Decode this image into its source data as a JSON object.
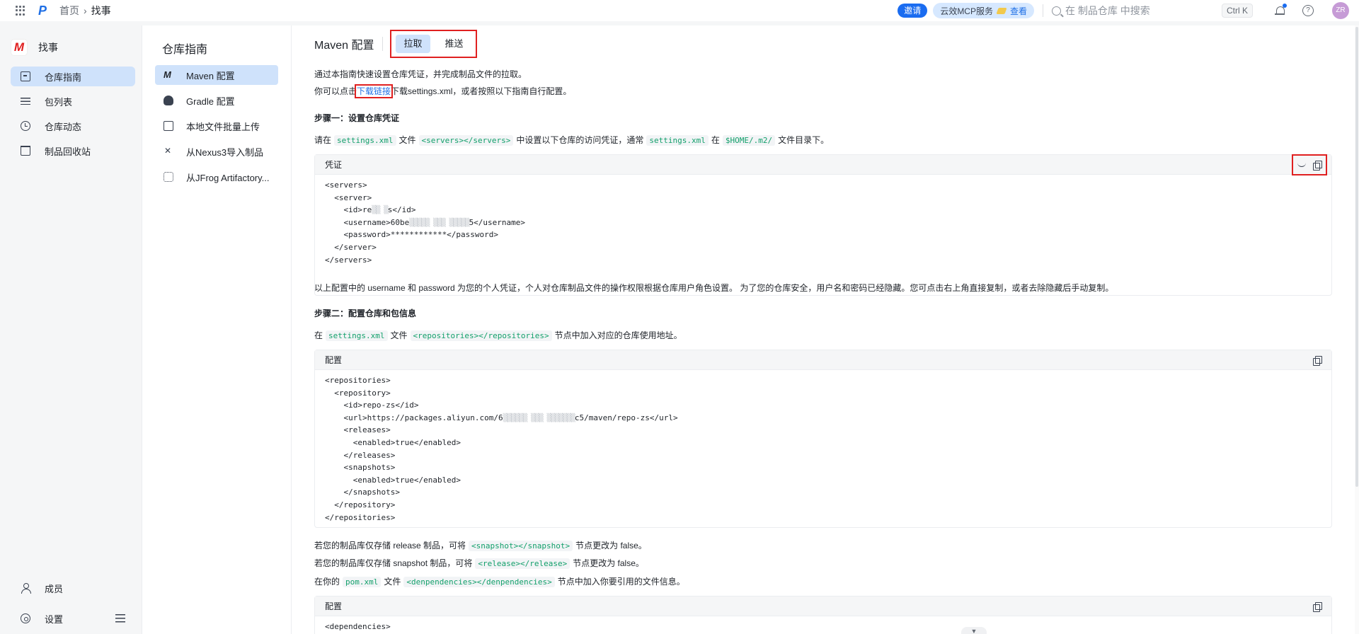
{
  "topbar": {
    "breadcrumb": {
      "home": "首页",
      "separator": "›",
      "current": "找事"
    },
    "invite_label": "邀请",
    "mcp_label": "云效MCP服务",
    "mcp_link": "查看",
    "search_placeholder": "在 制品仓库 中搜索",
    "shortcut": "Ctrl K",
    "avatar_initials": "ZR"
  },
  "leftnav": {
    "brand_logo": "M",
    "brand_name": "找事",
    "items": [
      {
        "label": "仓库指南",
        "icon": "doc-icon",
        "active": true
      },
      {
        "label": "包列表",
        "icon": "list-icon"
      },
      {
        "label": "仓库动态",
        "icon": "clock-icon"
      },
      {
        "label": "制品回收站",
        "icon": "trash-icon"
      }
    ],
    "bottom": [
      {
        "label": "成员",
        "icon": "user-icon"
      },
      {
        "label": "设置",
        "icon": "gear-icon"
      }
    ]
  },
  "midpanel": {
    "title": "仓库指南",
    "items": [
      {
        "label": "Maven 配置",
        "icon": "M",
        "active": true
      },
      {
        "label": "Gradle 配置",
        "icon": "gradle-icon"
      },
      {
        "label": "本地文件批量上传",
        "icon": "upload-icon"
      },
      {
        "label": "从Nexus3导入制品",
        "icon": "nexus-icon"
      },
      {
        "label": "从JFrog Artifactory...",
        "icon": "jfrog-icon"
      }
    ]
  },
  "content": {
    "title": "Maven 配置",
    "tabs": [
      "拉取",
      "推送"
    ],
    "intro1": "通过本指南快速设置仓库凭证，并完成制品文件的拉取。",
    "intro2_pre": "你可以点击",
    "intro2_link": "下载链接",
    "intro2_post": "下载settings.xml，或者按照以下指南自行配置。",
    "step1": "步骤一：设置仓库凭证",
    "step1_desc": {
      "t1": "请在",
      "c1": "settings.xml",
      "t2": "文件",
      "c2": "<servers></servers>",
      "t3": "中设置以下仓库的访问凭证，通常",
      "c3": "settings.xml",
      "t4": "在",
      "c4": "$HOME/.m2/",
      "t5": "文件目录下。"
    },
    "cred_panel_title": "凭证",
    "cred_code": {
      "l1": "<servers>",
      "l2": "  <server>",
      "l3_a": "    <id>re",
      "l3_blur": "▒▒ ▒",
      "l3_b": "s</id>",
      "l4_a": "    <username>60be",
      "l4_blur": "▒▒▒▒▒ ▒▒▒ ▒▒▒▒▒",
      "l4_b": "5</username>",
      "l5": "    <password>************</password>",
      "l6": "  </server>",
      "l7": "</servers>"
    },
    "cred_note": "以上配置中的 username 和 password 为您的个人凭证，个人对仓库制品文件的操作权限根据仓库用户角色设置。 为了您的仓库安全，用户名和密码已经隐藏。您可点击右上角直接复制，或者去除隐藏后手动复制。",
    "step2": "步骤二：配置仓库和包信息",
    "step2_desc": {
      "t1": "在",
      "c1": "settings.xml",
      "t2": "文件",
      "c2": "<repositories></repositories>",
      "t3": "节点中加入对应的仓库使用地址。"
    },
    "config_panel_title": "配置",
    "repo_code": {
      "l1": "<repositories>",
      "l2": "  <repository>",
      "l3": "    <id>repo-zs</id>",
      "l4_a": "    <url>https://packages.aliyun.com/6",
      "l4_blur": "▒▒▒▒▒▒ ▒▒▒ ▒▒▒▒▒▒▒",
      "l4_b": "c5/maven/repo-zs</url>",
      "l5": "    <releases>",
      "l6": "      <enabled>true</enabled>",
      "l7": "    </releases>",
      "l8": "    <snapshots>",
      "l9": "      <enabled>true</enabled>",
      "l10": "    </snapshots>",
      "l11": "  </repository>",
      "l12": "</repositories>"
    },
    "note_release": {
      "t1": "若您的制品库仅存储 release 制品，可将",
      "c1": "<snapshot></snapshot>",
      "t2": "节点更改为 false。"
    },
    "note_snapshot": {
      "t1": "若您的制品库仅存储 snapshot 制品，可将",
      "c1": "<release></release>",
      "t2": "节点更改为 false。"
    },
    "note_pom": {
      "t1": "在你的",
      "c1": "pom.xml",
      "t2": "文件",
      "c2": "<denpendencies></denpendencies>",
      "t3": "节点中加入你要引用的文件信息。"
    },
    "dep_panel_title": "配置",
    "dep_code_l1": "<dependencies>",
    "down_arrow": "▼"
  }
}
